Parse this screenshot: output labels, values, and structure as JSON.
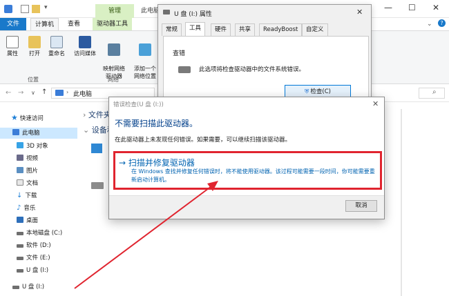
{
  "explorer": {
    "title": "此电脑",
    "tab_manage": "管理",
    "tabs": [
      "文件",
      "计算机",
      "查看",
      "驱动器工具"
    ],
    "window_buttons": {
      "minimize": "—",
      "maximize": "☐",
      "close": "✕"
    },
    "ribbon_buttons": [
      {
        "label": "属性",
        "icon": "properties-icon"
      },
      {
        "label": "打开",
        "icon": "open-icon"
      },
      {
        "label": "重命名",
        "icon": "rename-icon"
      },
      {
        "label": "访问媒体",
        "icon": "media-icon"
      },
      {
        "label": "映射网络\n驱动器",
        "icon": "map-drive-icon"
      },
      {
        "label": "添加一个\n网络位置",
        "icon": "network-location-icon"
      }
    ],
    "group_labels": [
      "位置",
      "网络"
    ],
    "address": "此电脑",
    "sidebar": [
      {
        "label": "快速访问",
        "icon": "star-icon"
      },
      {
        "label": "此电脑",
        "icon": "computer-icon"
      },
      {
        "label": "3D 对象",
        "icon": "3d-icon"
      },
      {
        "label": "视频",
        "icon": "video-icon"
      },
      {
        "label": "图片",
        "icon": "picture-icon"
      },
      {
        "label": "文档",
        "icon": "document-icon"
      },
      {
        "label": "下载",
        "icon": "download-icon"
      },
      {
        "label": "音乐",
        "icon": "music-icon"
      },
      {
        "label": "桌面",
        "icon": "desktop-icon"
      },
      {
        "label": "本地磁盘 (C:)",
        "icon": "disk-icon"
      },
      {
        "label": "软件 (D:)",
        "icon": "disk-icon"
      },
      {
        "label": "文件 (E:)",
        "icon": "disk-icon"
      },
      {
        "label": "U 盘 (I:)",
        "icon": "usb-icon"
      },
      {
        "label": "U 盘 (I:)",
        "icon": "usb-icon"
      }
    ],
    "content_groups": [
      "文件夹",
      "设备和"
    ]
  },
  "props": {
    "title": "U 盘 (I:) 属性",
    "tabs": [
      "常规",
      "工具",
      "硬件",
      "共享",
      "ReadyBoost",
      "自定义"
    ],
    "section": "查错",
    "desc": "此选项将检查驱动器中的文件系统错误。",
    "check_button": "检查(C)"
  },
  "dialog": {
    "title": "错误检查(U 盘 (I:))",
    "heading": "不需要扫描此驱动器。",
    "subtext": "在此驱动器上未发现任何错误。如果需要，可以继续扫描该驱动器。",
    "option_title": "→ 扫描并修复驱动器",
    "option_desc": "在 Windows 查找并修复任何错误时，将不能使用驱动器。该过程可能需要一段时间，你可能需要重新启动计算机。",
    "cancel": "取消"
  },
  "colors": {
    "accent": "#1979ca",
    "highlight": "#e0242f",
    "link": "#0063b1"
  }
}
